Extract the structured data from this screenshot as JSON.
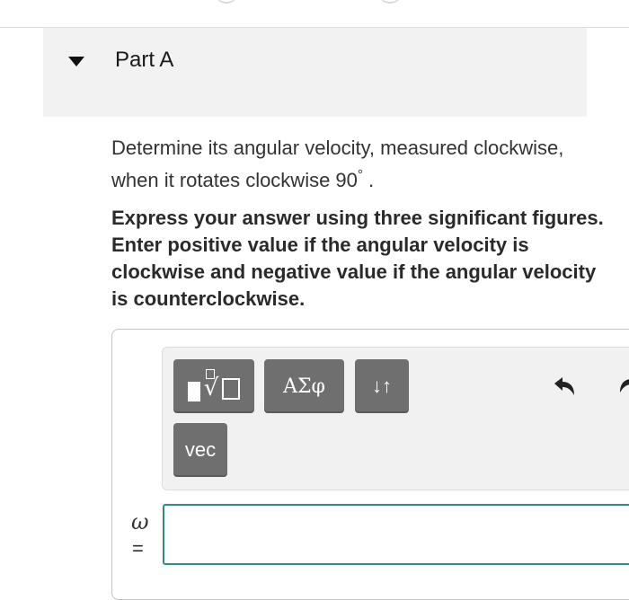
{
  "part": {
    "title": "Part A"
  },
  "question": {
    "text_before": "Determine its angular velocity, measured clockwise, when it rotates clockwise 90",
    "degree": "°",
    "text_after": "."
  },
  "instructions": "Express your answer using three significant figures. Enter positive value if the angular velocity is clockwise and negative value if the angular velocity is counterclockwise.",
  "toolbar": {
    "symbols_label": "ΑΣφ",
    "arrows_label": "↓↑",
    "vec_label": "vec"
  },
  "answer": {
    "variable": "ω",
    "equals": "=",
    "value": ""
  },
  "colors": {
    "button_gray": "#6f6f6f",
    "input_border": "#2e8c8c",
    "header_bg": "#f2f2f2"
  }
}
